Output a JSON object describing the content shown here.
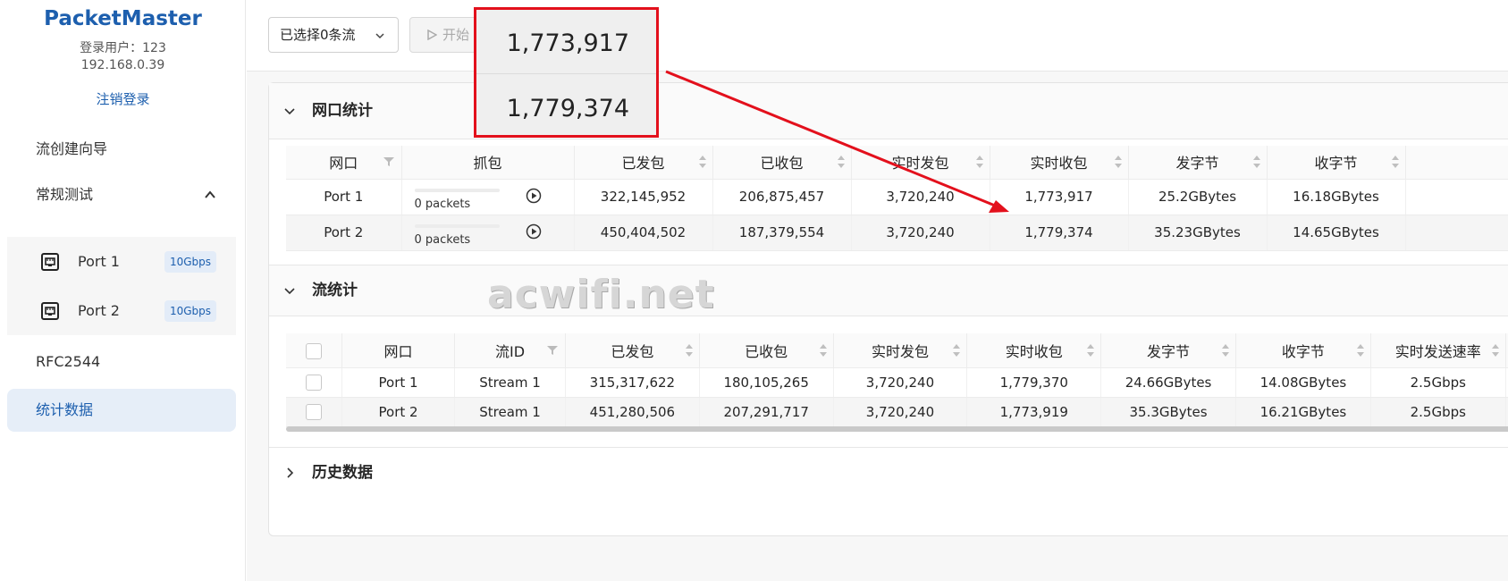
{
  "sidebar": {
    "brand": "PacketMaster",
    "user_line": "登录用户：123",
    "ip_line": "192.168.0.39",
    "logout": "注销登录",
    "nav": {
      "wizard": "流创建向导",
      "regular_test": "常规测试",
      "rfc": "RFC2544",
      "stats": "统计数据"
    },
    "ports": [
      {
        "label": "Port 1",
        "speed": "10Gbps"
      },
      {
        "label": "Port 2",
        "speed": "10Gbps"
      }
    ],
    "active_color": "#1d5fae"
  },
  "toolbar": {
    "select_label": "已选择0条流",
    "start_label": "开始"
  },
  "port_section": {
    "title": "网口统计",
    "headers": [
      "网口",
      "抓包",
      "已发包",
      "已收包",
      "实时发包",
      "实时收包",
      "发字节",
      "收字节"
    ],
    "rows": [
      {
        "port": "Port 1",
        "capture": "0 packets",
        "sent": "322,145,952",
        "received": "206,875,457",
        "rt_sent": "3,720,240",
        "rt_recv": "1,773,917",
        "tx_bytes": "25.2GBytes",
        "rx_bytes": "16.18GBytes"
      },
      {
        "port": "Port 2",
        "capture": "0 packets",
        "sent": "450,404,502",
        "received": "187,379,554",
        "rt_sent": "3,720,240",
        "rt_recv": "1,779,374",
        "tx_bytes": "35.23GBytes",
        "rx_bytes": "14.65GBytes"
      }
    ]
  },
  "stream_section": {
    "title": "流统计",
    "headers": [
      "网口",
      "流ID",
      "已发包",
      "已收包",
      "实时发包",
      "实时收包",
      "发字节",
      "收字节",
      "实时发送速率"
    ],
    "rows": [
      {
        "port": "Port 1",
        "stream": "Stream 1",
        "sent": "315,317,622",
        "received": "180,105,265",
        "rt_sent": "3,720,240",
        "rt_recv": "1,779,370",
        "tx_bytes": "24.66GBytes",
        "rx_bytes": "14.08GBytes",
        "rate": "2.5Gbps"
      },
      {
        "port": "Port 2",
        "stream": "Stream 1",
        "sent": "451,280,506",
        "received": "207,291,717",
        "rt_sent": "3,720,240",
        "rt_recv": "1,773,919",
        "tx_bytes": "35.3GBytes",
        "rx_bytes": "16.21GBytes",
        "rate": "2.5Gbps"
      }
    ]
  },
  "history_section": {
    "title": "历史数据"
  },
  "watermark": "acwifi.net",
  "annotation": {
    "value_1": "1,773,917",
    "value_2": "1,779,374",
    "color": "#e3101c"
  }
}
